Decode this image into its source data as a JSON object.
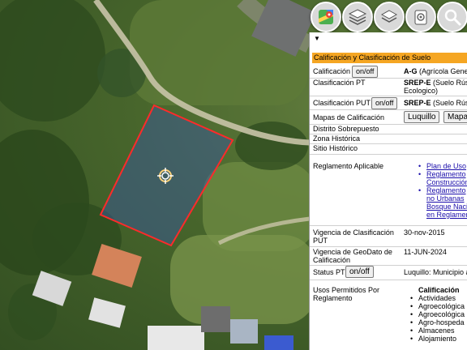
{
  "toolbar": {
    "icons": [
      "google-maps-icon",
      "layers-icon",
      "layers-alt-icon",
      "tags-icon",
      "search-icon"
    ]
  },
  "panel": {
    "section_title": "Calificación y Clasificación de Suelo",
    "rows": {
      "calificacion": {
        "label": "Calificación",
        "button": "on/off",
        "value_bold": "A-G",
        "value_rest": " (Agrícola General)"
      },
      "clasificacion_pt": {
        "label": "Clasificación PT",
        "value_bold": "SREP-E",
        "value_rest": " (Suelo Rústico",
        "value_line2": "Ecologico)"
      },
      "clasificacion_put": {
        "label": "Clasificación PUT",
        "button": "on/off",
        "value_bold": "SREP-E",
        "value_rest": " (Suelo Rústico"
      },
      "mapas": {
        "label": "Mapas de Calificación",
        "btn1": "Luquillo",
        "btn2": "Mapas"
      },
      "distrito": {
        "label": "Distrito Sobrepuesto"
      },
      "zona": {
        "label": "Zona Histórica"
      },
      "sitio": {
        "label": "Sitio Histórico"
      },
      "reglamento": {
        "label": "Reglamento Aplicable",
        "links": [
          "Plan de Uso",
          "Reglamento",
          "Construcción",
          "Reglamento",
          "no Urbanas",
          "Bosque Naci",
          "en Reglamen"
        ]
      },
      "vigencia_put": {
        "label": "Vigencia de Clasificación",
        "label2": "PUT",
        "value": "30-nov-2015"
      },
      "vigencia_geo": {
        "label": "Vigencia de GeoDato de",
        "label2": "Calificación",
        "value": "11-JUN-2024"
      },
      "status_pt": {
        "label": "Status PT",
        "button": "on/off",
        "value": "Luquillo: Municipio a"
      },
      "usos": {
        "label": "Usos Permitidos Por",
        "label2": "Reglamento",
        "heading": "Calificación",
        "items": [
          "Actividades",
          "Agroecológica",
          "Agroecológica",
          "Agro-hospeda",
          "Almacenes",
          "Alojamiento"
        ]
      }
    }
  }
}
